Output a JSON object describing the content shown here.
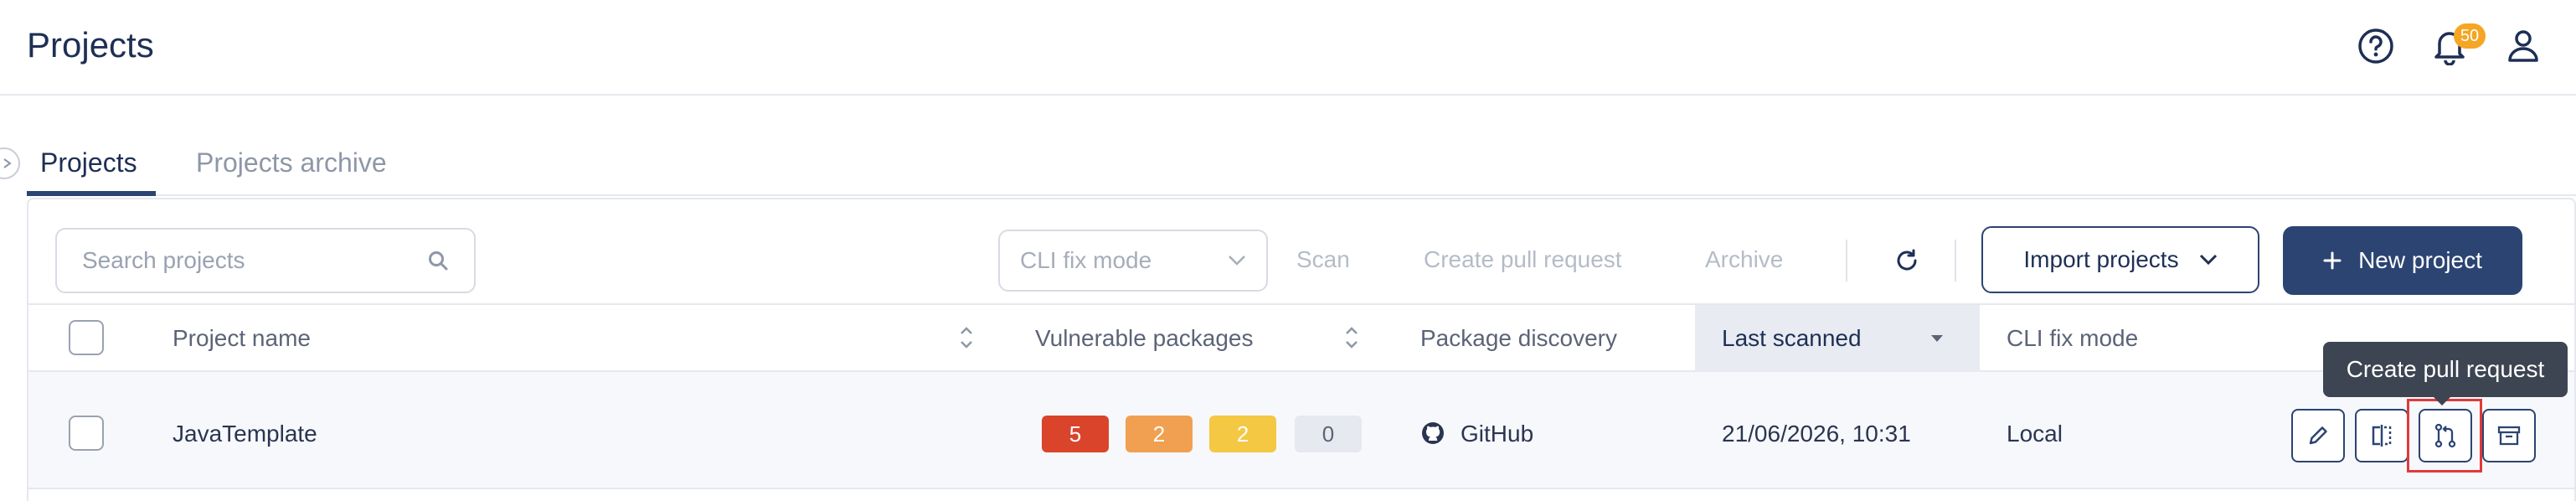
{
  "header": {
    "title": "Projects",
    "notification_count": "50",
    "icons": [
      "help-icon",
      "bell-icon",
      "user-icon"
    ]
  },
  "tabs": [
    {
      "label": "Projects",
      "active": true
    },
    {
      "label": "Projects archive",
      "active": false
    }
  ],
  "toolbar": {
    "search_placeholder": "Search projects",
    "fix_mode_placeholder": "CLI fix mode",
    "scan_label": "Scan",
    "create_pr_label": "Create pull request",
    "archive_label": "Archive",
    "import_label": "Import projects",
    "new_project_label": "New project"
  },
  "table": {
    "columns": {
      "project_name": "Project name",
      "vulnerable_packages": "Vulnerable packages",
      "package_discovery": "Package discovery",
      "last_scanned": "Last scanned",
      "cli_fix_mode": "CLI fix mode"
    },
    "rows": [
      {
        "project_name": "JavaTemplate",
        "vulnerabilities": {
          "critical": "5",
          "high": "2",
          "medium": "2",
          "low": "0"
        },
        "package_discovery": "GitHub",
        "last_scanned": "21/06/2026, 10:31",
        "cli_fix_mode": "Local"
      }
    ]
  },
  "tooltip": {
    "text": "Create pull request"
  },
  "colors": {
    "primary": "#2b4472",
    "critical": "#d9442b",
    "high": "#f0a050",
    "medium": "#f4c842",
    "low": "#e6e9ef",
    "badge": "#f5a623"
  }
}
